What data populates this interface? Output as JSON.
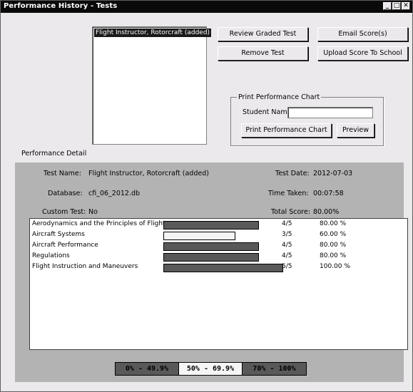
{
  "window": {
    "title": "Performance History - Tests",
    "controls": [
      "_",
      "□",
      "✕"
    ]
  },
  "tests_list": {
    "items": [
      "Flight Instructor, Rotorcraft (added)"
    ],
    "selected_index": 0
  },
  "buttons": {
    "review_graded_test": "Review Graded Test",
    "email_scores": "Email Score(s)",
    "remove_test": "Remove Test",
    "upload_score": "Upload Score To School",
    "print_performance_chart": "Print Performance Chart",
    "preview": "Preview"
  },
  "print_group": {
    "title": "Print Performance Chart",
    "student_name_label": "Student Name:",
    "student_name_value": ""
  },
  "detail": {
    "section_title": "Performance Detail",
    "test_name_label": "Test Name:",
    "test_name": "Flight Instructor, Rotorcraft (added)",
    "database_label": "Database:",
    "database": "cfi_06_2012.db",
    "custom_test_label": "Custom Test:",
    "custom_test": "No",
    "test_date_label": "Test Date:",
    "test_date": "2012-07-03",
    "time_taken_label": "Time Taken:",
    "time_taken": "00:07:58",
    "total_score_label": "Total Score:",
    "total_score": "80.00%"
  },
  "scores": [
    {
      "name": "Aerodynamics and the Principles of Flight",
      "fraction": "4/5",
      "percent": "80.00 %",
      "value": 0.8
    },
    {
      "name": "Aircraft Systems",
      "fraction": "3/5",
      "percent": "60.00 %",
      "value": 0.6
    },
    {
      "name": "Aircraft Performance",
      "fraction": "4/5",
      "percent": "80.00 %",
      "value": 0.8
    },
    {
      "name": "Regulations",
      "fraction": "4/5",
      "percent": "80.00 %",
      "value": 0.8
    },
    {
      "name": "Flight Instruction and Maneuvers",
      "fraction": "5/5",
      "percent": "100.00 %",
      "value": 1.0
    }
  ],
  "legend": [
    {
      "label": "0% - 49.9%",
      "color": "#595959",
      "text_color": "#000000"
    },
    {
      "label": "50% - 69.9%",
      "color": "#f5f5f5",
      "text_color": "#000000"
    },
    {
      "label": "70% - 100%",
      "color": "#595959",
      "text_color": "#000000"
    }
  ],
  "colors": {
    "low": "#595959",
    "mid": "#f5f5f5",
    "high": "#595959"
  }
}
